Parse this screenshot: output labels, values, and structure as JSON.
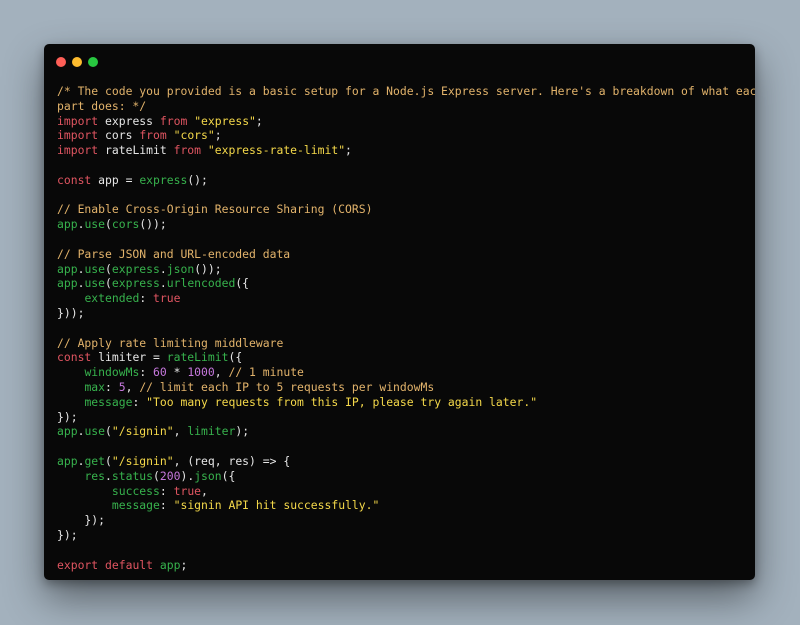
{
  "window": {
    "controls": [
      {
        "name": "close",
        "color": "#ff5f57"
      },
      {
        "name": "minimize",
        "color": "#febc2e"
      },
      {
        "name": "zoom",
        "color": "#28c840"
      }
    ]
  },
  "theme": {
    "default": "#e6e6e6",
    "comment": "#e2b36b",
    "keyword": "#e05561",
    "string": "#f5d94a",
    "function": "#37b24d",
    "number": "#c678dd",
    "plain": "#e6e6e6"
  },
  "code": {
    "lines": [
      [
        [
          "comment",
          "/* The code you provided is a basic setup for a Node.js Express server. Here's a breakdown of what each"
        ]
      ],
      [
        [
          "comment",
          "part does: */"
        ]
      ],
      [
        [
          "keyword",
          "import"
        ],
        [
          "plain",
          " express "
        ],
        [
          "keyword",
          "from"
        ],
        [
          "plain",
          " "
        ],
        [
          "string",
          "\"express\""
        ],
        [
          "plain",
          ";"
        ]
      ],
      [
        [
          "keyword",
          "import"
        ],
        [
          "plain",
          " cors "
        ],
        [
          "keyword",
          "from"
        ],
        [
          "plain",
          " "
        ],
        [
          "string",
          "\"cors\""
        ],
        [
          "plain",
          ";"
        ]
      ],
      [
        [
          "keyword",
          "import"
        ],
        [
          "plain",
          " rateLimit "
        ],
        [
          "keyword",
          "from"
        ],
        [
          "plain",
          " "
        ],
        [
          "string",
          "\"express-rate-limit\""
        ],
        [
          "plain",
          ";"
        ]
      ],
      [],
      [
        [
          "keyword",
          "const"
        ],
        [
          "plain",
          " app = "
        ],
        [
          "function",
          "express"
        ],
        [
          "plain",
          "();"
        ]
      ],
      [],
      [
        [
          "comment",
          "// Enable Cross-Origin Resource Sharing (CORS)"
        ]
      ],
      [
        [
          "function",
          "app"
        ],
        [
          "plain",
          "."
        ],
        [
          "function",
          "use"
        ],
        [
          "plain",
          "("
        ],
        [
          "function",
          "cors"
        ],
        [
          "plain",
          "());"
        ]
      ],
      [],
      [
        [
          "comment",
          "// Parse JSON and URL-encoded data"
        ]
      ],
      [
        [
          "function",
          "app"
        ],
        [
          "plain",
          "."
        ],
        [
          "function",
          "use"
        ],
        [
          "plain",
          "("
        ],
        [
          "function",
          "express"
        ],
        [
          "plain",
          "."
        ],
        [
          "function",
          "json"
        ],
        [
          "plain",
          "());"
        ]
      ],
      [
        [
          "function",
          "app"
        ],
        [
          "plain",
          "."
        ],
        [
          "function",
          "use"
        ],
        [
          "plain",
          "("
        ],
        [
          "function",
          "express"
        ],
        [
          "plain",
          "."
        ],
        [
          "function",
          "urlencoded"
        ],
        [
          "plain",
          "({"
        ]
      ],
      [
        [
          "plain",
          "    "
        ],
        [
          "function",
          "extended"
        ],
        [
          "plain",
          ": "
        ],
        [
          "keyword",
          "true"
        ]
      ],
      [
        [
          "plain",
          "}));"
        ]
      ],
      [],
      [
        [
          "comment",
          "// Apply rate limiting middleware"
        ]
      ],
      [
        [
          "keyword",
          "const"
        ],
        [
          "plain",
          " limiter = "
        ],
        [
          "function",
          "rateLimit"
        ],
        [
          "plain",
          "({"
        ]
      ],
      [
        [
          "plain",
          "    "
        ],
        [
          "function",
          "windowMs"
        ],
        [
          "plain",
          ": "
        ],
        [
          "number",
          "60"
        ],
        [
          "plain",
          " * "
        ],
        [
          "number",
          "1000"
        ],
        [
          "plain",
          ", "
        ],
        [
          "comment",
          "// 1 minute"
        ]
      ],
      [
        [
          "plain",
          "    "
        ],
        [
          "function",
          "max"
        ],
        [
          "plain",
          ": "
        ],
        [
          "number",
          "5"
        ],
        [
          "plain",
          ", "
        ],
        [
          "comment",
          "// limit each IP to 5 requests per windowMs"
        ]
      ],
      [
        [
          "plain",
          "    "
        ],
        [
          "function",
          "message"
        ],
        [
          "plain",
          ": "
        ],
        [
          "string",
          "\"Too many requests from this IP, please try again later.\""
        ]
      ],
      [
        [
          "plain",
          "});"
        ]
      ],
      [
        [
          "function",
          "app"
        ],
        [
          "plain",
          "."
        ],
        [
          "function",
          "use"
        ],
        [
          "plain",
          "("
        ],
        [
          "string",
          "\"/signin\""
        ],
        [
          "plain",
          ", "
        ],
        [
          "function",
          "limiter"
        ],
        [
          "plain",
          ");"
        ]
      ],
      [],
      [
        [
          "function",
          "app"
        ],
        [
          "plain",
          "."
        ],
        [
          "function",
          "get"
        ],
        [
          "plain",
          "("
        ],
        [
          "string",
          "\"/signin\""
        ],
        [
          "plain",
          ", (req, res) => {"
        ]
      ],
      [
        [
          "plain",
          "    "
        ],
        [
          "function",
          "res"
        ],
        [
          "plain",
          "."
        ],
        [
          "function",
          "status"
        ],
        [
          "plain",
          "("
        ],
        [
          "number",
          "200"
        ],
        [
          "plain",
          ")."
        ],
        [
          "function",
          "json"
        ],
        [
          "plain",
          "({"
        ]
      ],
      [
        [
          "plain",
          "        "
        ],
        [
          "function",
          "success"
        ],
        [
          "plain",
          ": "
        ],
        [
          "keyword",
          "true"
        ],
        [
          "plain",
          ","
        ]
      ],
      [
        [
          "plain",
          "        "
        ],
        [
          "function",
          "message"
        ],
        [
          "plain",
          ": "
        ],
        [
          "string",
          "\"signin API hit successfully.\""
        ]
      ],
      [
        [
          "plain",
          "    });"
        ]
      ],
      [
        [
          "plain",
          "});"
        ]
      ],
      [],
      [
        [
          "keyword",
          "export"
        ],
        [
          "plain",
          " "
        ],
        [
          "keyword",
          "default"
        ],
        [
          "plain",
          " "
        ],
        [
          "function",
          "app"
        ],
        [
          "plain",
          ";"
        ]
      ]
    ]
  }
}
